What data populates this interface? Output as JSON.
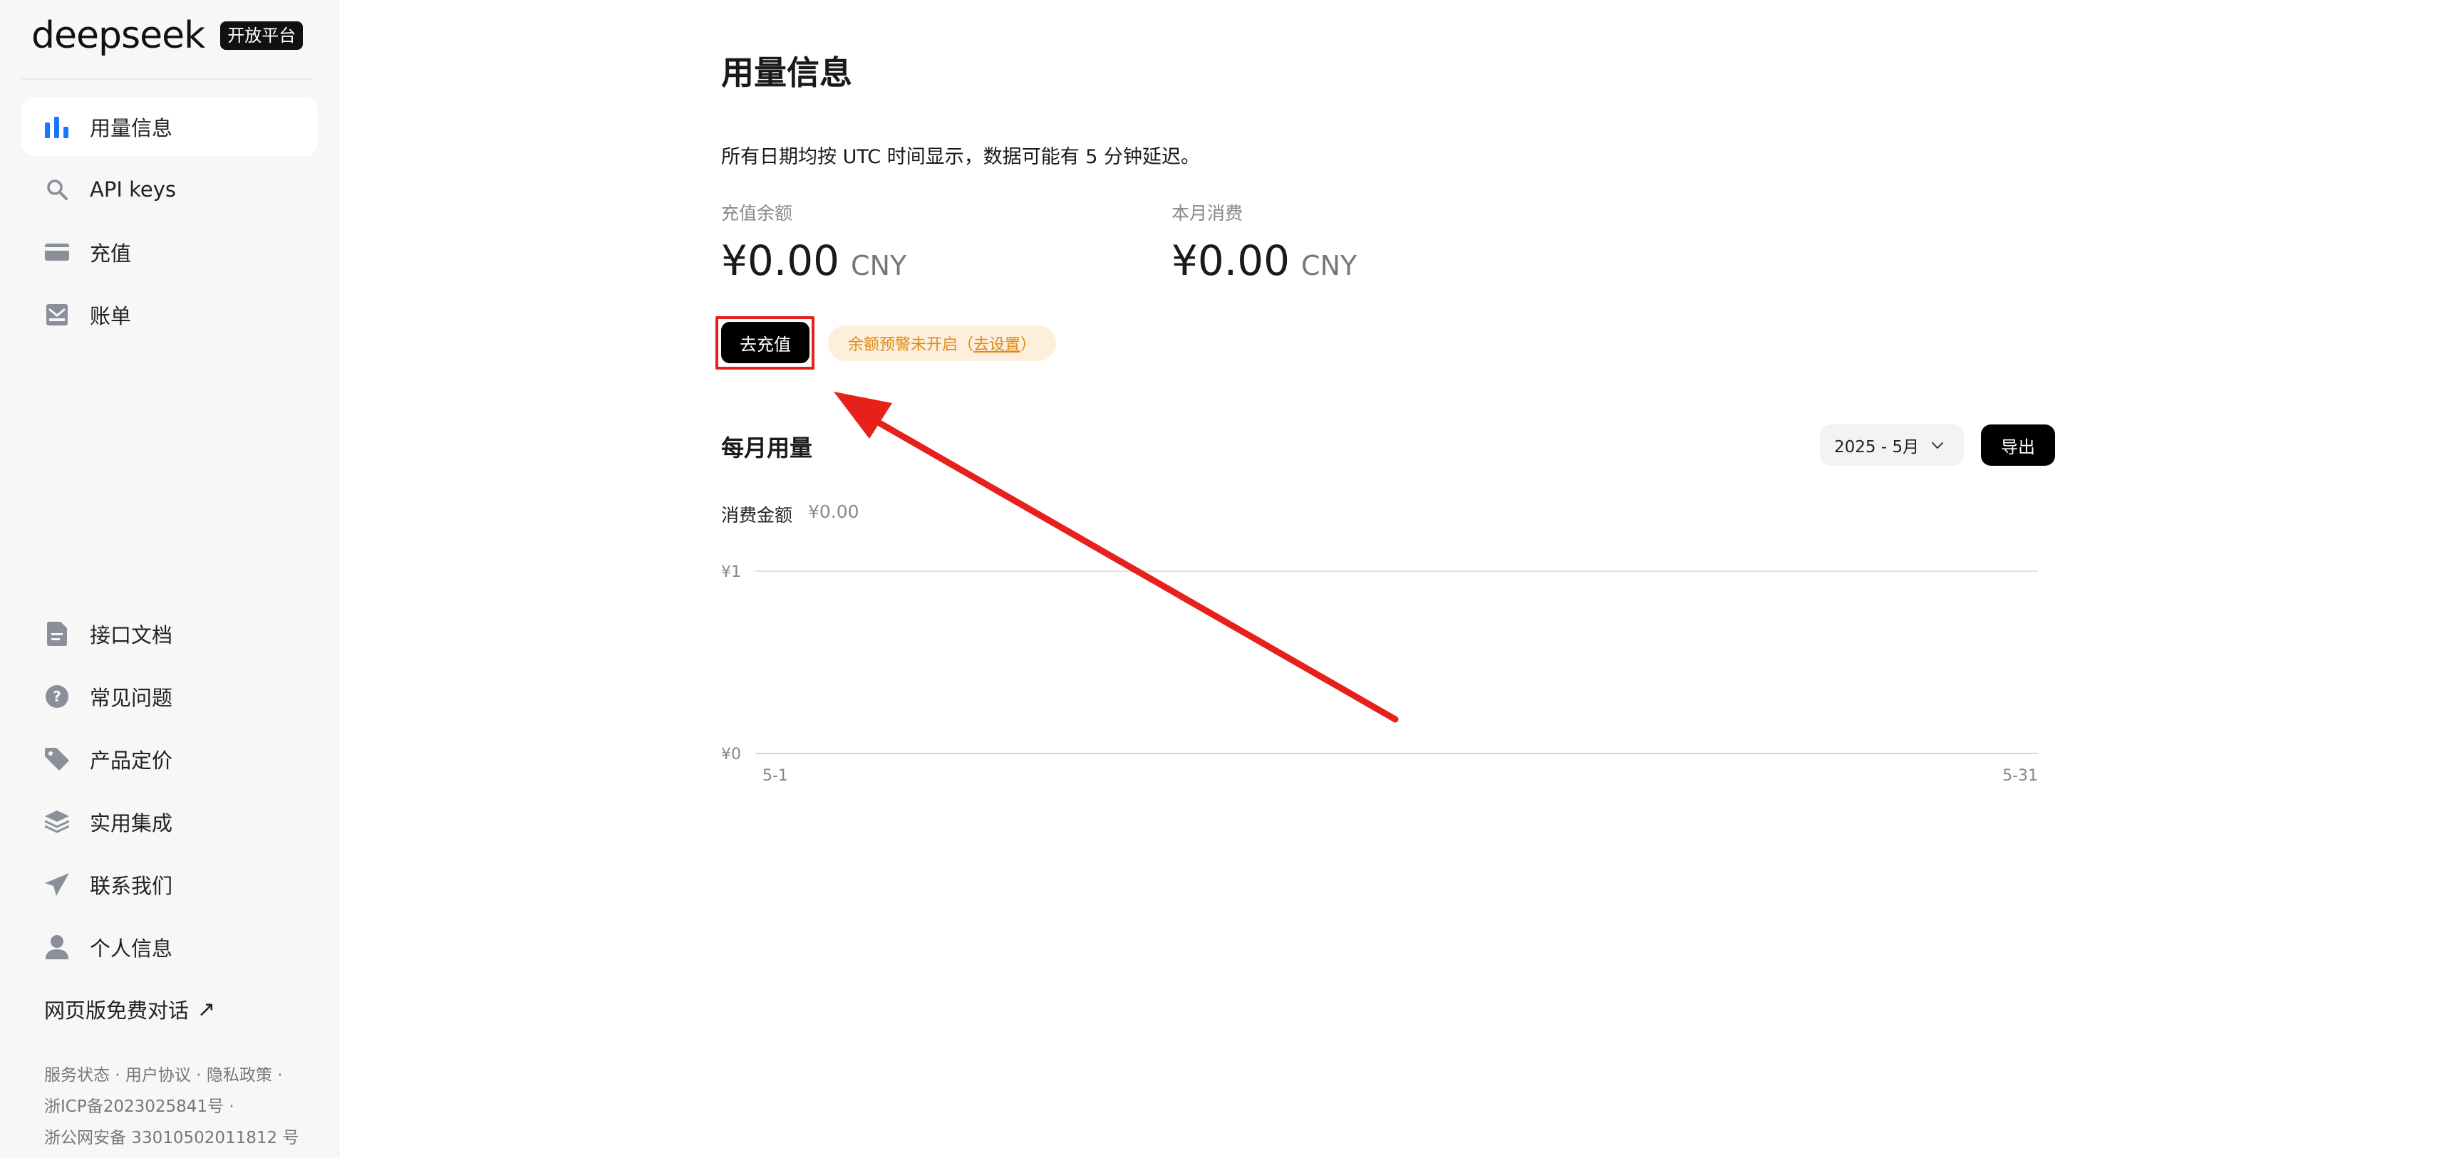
{
  "brand": {
    "name": "deepseek",
    "badge": "开放平台"
  },
  "sidebar": {
    "top_items": [
      {
        "label": "用量信息",
        "icon": "bar-chart-icon",
        "active": true
      },
      {
        "label": "API keys",
        "icon": "search-key-icon",
        "active": false
      },
      {
        "label": "充值",
        "icon": "credit-card-icon",
        "active": false
      },
      {
        "label": "账单",
        "icon": "inbox-icon",
        "active": false
      }
    ],
    "bottom_items": [
      {
        "label": "接口文档",
        "icon": "document-icon"
      },
      {
        "label": "常见问题",
        "icon": "question-icon"
      },
      {
        "label": "产品定价",
        "icon": "price-tag-icon"
      },
      {
        "label": "实用集成",
        "icon": "layers-icon"
      },
      {
        "label": "联系我们",
        "icon": "paper-plane-icon"
      },
      {
        "label": "个人信息",
        "icon": "user-icon"
      }
    ],
    "web_chat": "网页版免费对话",
    "footer": {
      "links": "服务状态 · 用户协议 · 隐私政策 ·",
      "icp": "浙ICP备2023025841号 ·",
      "police": "浙公网安备 33010502011812 号"
    }
  },
  "main": {
    "title": "用量信息",
    "notice": "所有日期均按 UTC 时间显示，数据可能有 5 分钟延迟。",
    "balance": {
      "label": "充值余额",
      "amount": "¥0.00",
      "unit": "CNY"
    },
    "monthly_spend": {
      "label": "本月消费",
      "amount": "¥0.00",
      "unit": "CNY"
    },
    "recharge_button": "去充值",
    "alert": {
      "text": "余额预警未开启（",
      "link": "去设置",
      "suffix": "）"
    },
    "usage": {
      "title": "每月用量",
      "month_select": "2025 - 5月",
      "export_button": "导出",
      "spend_label": "消费金额",
      "spend_value": "¥0.00"
    }
  },
  "chart_data": {
    "type": "line",
    "x_ticks": [
      "5-1",
      "5-31"
    ],
    "y_ticks": [
      "¥0",
      "¥1"
    ],
    "ylim": [
      0,
      1
    ],
    "series": [],
    "grid": true
  },
  "colors": {
    "accent": "#1677ff",
    "annotation": "#e8201c",
    "alert_bg": "#fdefdc",
    "alert_text": "#e08a16"
  }
}
